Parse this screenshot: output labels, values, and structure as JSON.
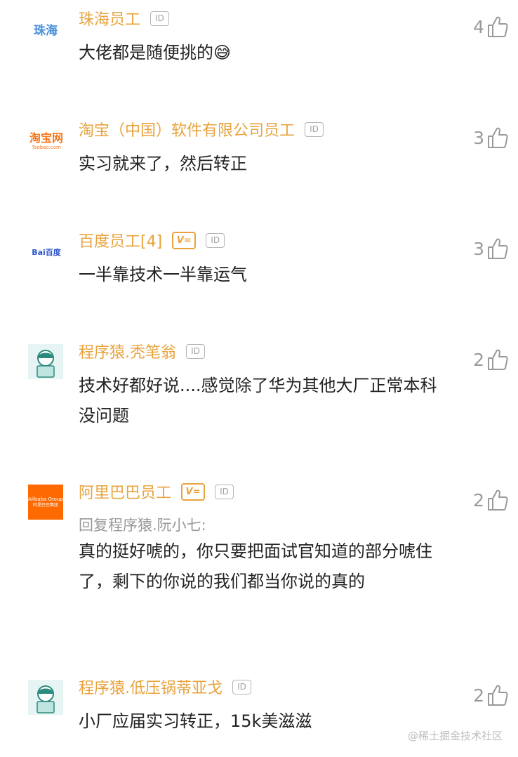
{
  "comments": [
    {
      "author": "珠海员工",
      "avatar_text": "珠海",
      "has_v": false,
      "id_badge": "ID",
      "reply_to": "",
      "content": "大佬都是随便挑的😅",
      "likes": "4"
    },
    {
      "author": "淘宝（中国）软件有限公司员工",
      "avatar_text": "淘宝网",
      "avatar_subtext": "Taobao.com",
      "has_v": false,
      "id_badge": "ID",
      "reply_to": "",
      "content": "实习就来了，然后转正",
      "likes": "3"
    },
    {
      "author": "百度员工[4]",
      "avatar_text": "Bai百度",
      "has_v": true,
      "v_badge": "V=",
      "id_badge": "ID",
      "reply_to": "",
      "content": "一半靠技术一半靠运气",
      "likes": "3"
    },
    {
      "author": "程序猿.秃笔翁",
      "avatar_text": "</>",
      "has_v": false,
      "id_badge": "ID",
      "reply_to": "",
      "content": "技术好都好说....感觉除了华为其他大厂正常本科没问题",
      "likes": "2"
    },
    {
      "author": "阿里巴巴员工",
      "avatar_text": "Alibaba Group",
      "avatar_subtext": "阿里巴巴集团",
      "has_v": true,
      "v_badge": "V=",
      "id_badge": "ID",
      "reply_to": "回复程序猿.阮小七:",
      "content": "真的挺好唬的，你只要把面试官知道的部分唬住了，剩下的你说的我们都当你说的真的",
      "likes": "2"
    },
    {
      "author": "程序猿.低压锅蒂亚戈",
      "avatar_text": "</>",
      "has_v": false,
      "id_badge": "ID",
      "reply_to": "",
      "content": "小厂应届实习转正，15k美滋滋",
      "likes": "2"
    }
  ],
  "watermark": "@稀土掘金技术社区",
  "colors": {
    "author": "#e8a33d",
    "content": "#222222",
    "reply": "#999999",
    "like": "#9a9a9a",
    "alibaba": "#ff6a00"
  }
}
